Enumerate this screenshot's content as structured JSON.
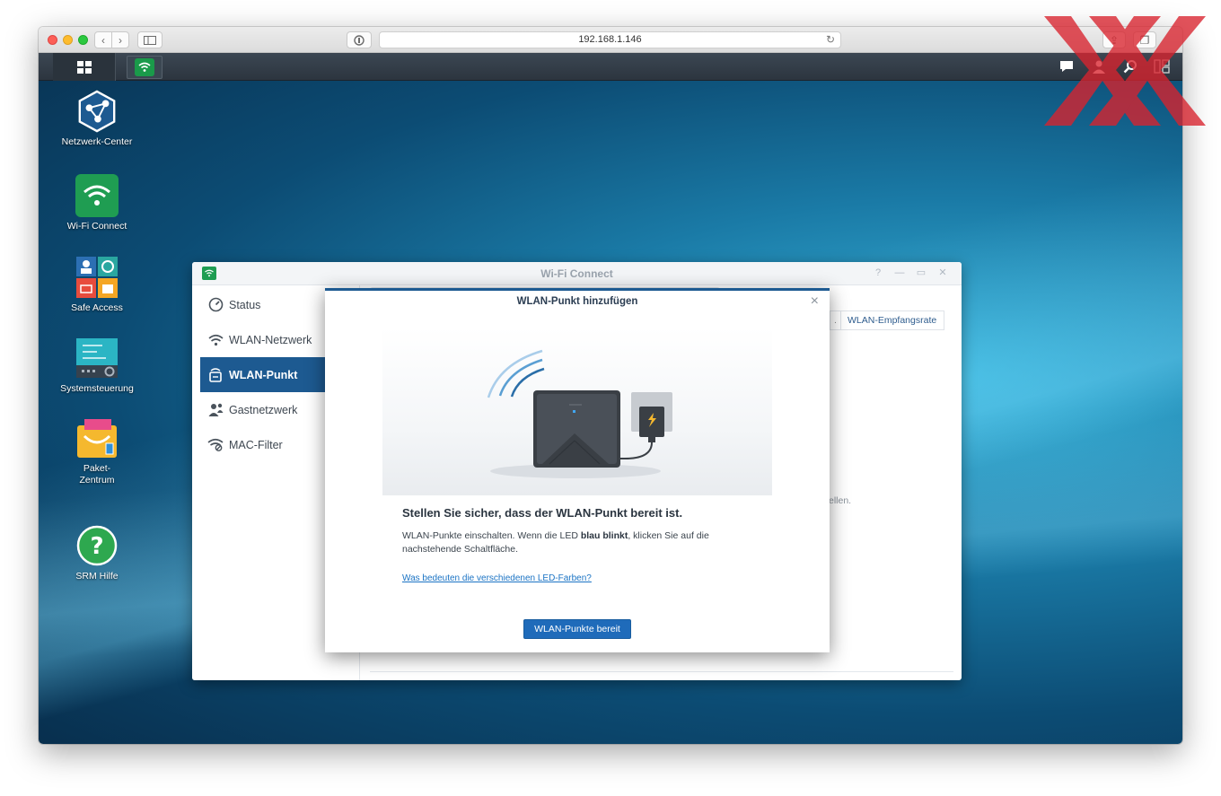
{
  "browser": {
    "url": "192.168.1.146"
  },
  "desktop_icons": [
    {
      "label": "Netzwerk-Center"
    },
    {
      "label": "Wi-Fi Connect"
    },
    {
      "label": "Safe Access"
    },
    {
      "label": "Systemsteuerung"
    },
    {
      "label": "Paket-\nZentrum"
    },
    {
      "label": "SRM Hilfe"
    }
  ],
  "app_window": {
    "title": "Wi-Fi Connect",
    "sidebar": [
      {
        "label": "Status",
        "icon": "gauge-icon"
      },
      {
        "label": "WLAN-Netzwerk",
        "icon": "wifi-icon"
      },
      {
        "label": "WLAN-Punkt",
        "icon": "access-point-icon",
        "active": true
      },
      {
        "label": "Gastnetzwerk",
        "icon": "guest-icon"
      },
      {
        "label": "MAC-Filter",
        "icon": "mac-filter-icon"
      }
    ],
    "column_header": "WLAN-Empfangsrate",
    "column_header_left": ".",
    "behind_text": "ellen."
  },
  "modal": {
    "title": "WLAN-Punkt hinzufügen",
    "heading": "Stellen Sie sicher, dass der WLAN-Punkt bereit ist.",
    "body_part1": "WLAN-Punkte einschalten. Wenn die LED ",
    "body_bold": "blau blinkt",
    "body_part2": ", klicken Sie auf die nachstehende Schaltfläche.",
    "link": "Was bedeuten die verschiedenen LED-Farben?",
    "button": "WLAN-Punkte bereit"
  },
  "colors": {
    "accent": "#1d5a91",
    "button": "#1f6bba",
    "link": "#1a73c4",
    "wifi_green": "#1f9d52",
    "watermark_red": "#d9232e"
  }
}
